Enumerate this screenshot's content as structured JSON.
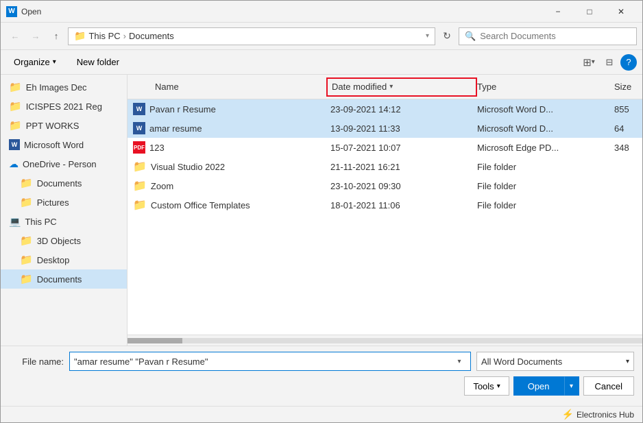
{
  "titleBar": {
    "icon": "W",
    "title": "Open",
    "closeBtn": "✕",
    "minimizeBtn": "−",
    "maximizeBtn": "□"
  },
  "addressBar": {
    "backBtn": "←",
    "forwardBtn": "→",
    "upBtn": "↑",
    "pathParts": [
      "This PC",
      "Documents"
    ],
    "refreshBtn": "↻",
    "searchPlaceholder": "Search Documents"
  },
  "toolbar": {
    "organizeLabel": "Organize",
    "newFolderLabel": "New folder",
    "viewIcon": "⊞",
    "helpIcon": "?"
  },
  "sidebar": {
    "items": [
      {
        "id": "eh-images",
        "label": "Eh Images Dec",
        "icon": "folder",
        "indent": 0
      },
      {
        "id": "icispes",
        "label": "ICISPES 2021 Reg",
        "icon": "folder",
        "indent": 0
      },
      {
        "id": "ppt-works",
        "label": "PPT WORKS",
        "icon": "folder",
        "indent": 0
      },
      {
        "id": "microsoft-word",
        "label": "Microsoft Word",
        "icon": "word",
        "indent": 0
      },
      {
        "id": "onedrive",
        "label": "OneDrive - Person",
        "icon": "onedrive",
        "indent": 0
      },
      {
        "id": "documents-od",
        "label": "Documents",
        "icon": "folder-blue",
        "indent": 1
      },
      {
        "id": "pictures",
        "label": "Pictures",
        "icon": "folder-blue",
        "indent": 1
      },
      {
        "id": "this-pc",
        "label": "This PC",
        "icon": "pc",
        "indent": 0
      },
      {
        "id": "3d-objects",
        "label": "3D Objects",
        "icon": "folder-blue",
        "indent": 1
      },
      {
        "id": "desktop",
        "label": "Desktop",
        "icon": "folder-blue",
        "indent": 1
      },
      {
        "id": "documents",
        "label": "Documents",
        "icon": "folder-blue",
        "indent": 1,
        "active": true
      }
    ]
  },
  "fileTable": {
    "columns": [
      "Name",
      "Date modified",
      "Type",
      "Size"
    ],
    "rows": [
      {
        "id": "pavan-resume",
        "name": "Pavan r Resume",
        "icon": "word",
        "date": "23-09-2021 14:12",
        "type": "Microsoft Word D...",
        "size": "855",
        "selected": true
      },
      {
        "id": "amar-resume",
        "name": "amar resume",
        "icon": "word",
        "date": "13-09-2021 11:33",
        "type": "Microsoft Word D...",
        "size": "64",
        "selected": true
      },
      {
        "id": "file-123",
        "name": "123",
        "icon": "pdf",
        "date": "15-07-2021 10:07",
        "type": "Microsoft Edge PD...",
        "size": "348",
        "selected": false
      },
      {
        "id": "visual-studio",
        "name": "Visual Studio 2022",
        "icon": "folder",
        "date": "21-11-2021 16:21",
        "type": "File folder",
        "size": "",
        "selected": false
      },
      {
        "id": "zoom",
        "name": "Zoom",
        "icon": "folder",
        "date": "23-10-2021 09:30",
        "type": "File folder",
        "size": "",
        "selected": false
      },
      {
        "id": "custom-office",
        "name": "Custom Office Templates",
        "icon": "folder",
        "date": "18-01-2021 11:06",
        "type": "File folder",
        "size": "",
        "selected": false
      }
    ]
  },
  "bottomBar": {
    "fileNameLabel": "File name:",
    "fileNameValue": "\"amar resume\" \"Pavan r Resume\"",
    "fileTypeValue": "All Word Documents",
    "toolsLabel": "Tools",
    "openLabel": "Open",
    "cancelLabel": "Cancel"
  },
  "statusBar": {
    "brand": "Electronics Hub",
    "brandIcon": "⚡"
  }
}
